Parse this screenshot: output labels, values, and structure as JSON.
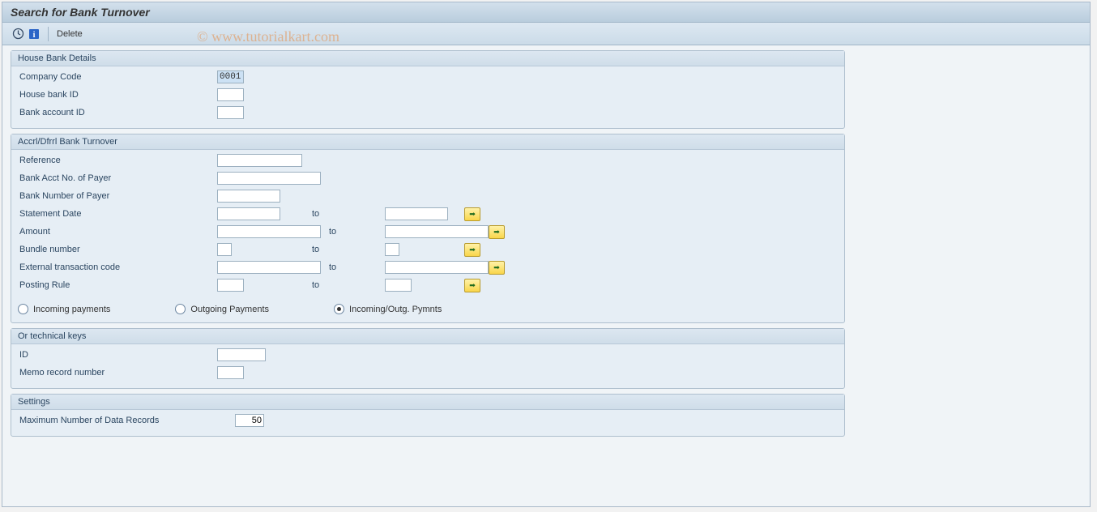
{
  "title": "Search for Bank Turnover",
  "toolbar": {
    "execute_tooltip": "Execute",
    "info_tooltip": "Info",
    "delete_label": "Delete"
  },
  "watermark": "© www.tutorialkart.com",
  "groups": {
    "house_bank": {
      "title": "House Bank Details",
      "fields": {
        "company_code": {
          "label": "Company Code",
          "value": "0001"
        },
        "house_bank_id": {
          "label": "House bank ID",
          "value": ""
        },
        "bank_account_id": {
          "label": "Bank account ID",
          "value": ""
        }
      }
    },
    "accrl": {
      "title": "Accrl/Dfrrl Bank Turnover",
      "fields": {
        "reference": {
          "label": "Reference",
          "value": ""
        },
        "bank_acct_payer": {
          "label": "Bank Acct No. of Payer",
          "value": ""
        },
        "bank_num_payer": {
          "label": "Bank Number of Payer",
          "value": ""
        },
        "stmt_date": {
          "label": "Statement Date",
          "from": "",
          "to": ""
        },
        "amount": {
          "label": "Amount",
          "from": "",
          "to": ""
        },
        "bundle_num": {
          "label": "Bundle number",
          "from": "",
          "to": ""
        },
        "ext_tc": {
          "label": "External transaction code",
          "from": "",
          "to": ""
        },
        "posting_rule": {
          "label": "Posting Rule",
          "from": "",
          "to": ""
        }
      },
      "to_label": "to",
      "radios": {
        "incoming": "Incoming payments",
        "outgoing": "Outgoing Payments",
        "both": "Incoming/Outg. Pymnts",
        "selected": "both"
      }
    },
    "tech": {
      "title": "Or technical keys",
      "fields": {
        "id": {
          "label": "ID",
          "value": ""
        },
        "memo": {
          "label": "Memo record number",
          "value": ""
        }
      }
    },
    "settings": {
      "title": "Settings",
      "fields": {
        "max_records": {
          "label": "Maximum Number of Data Records",
          "value": "50"
        }
      }
    }
  }
}
